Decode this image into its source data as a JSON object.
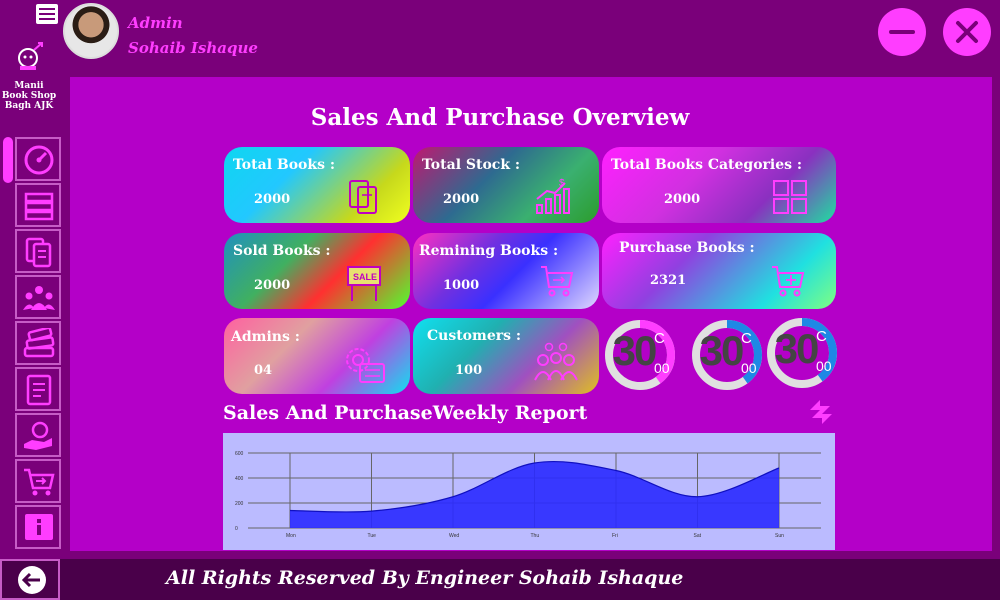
{
  "header": {
    "role": "Admin",
    "name": "Sohaib Ishaque"
  },
  "sidebar": {
    "shop_name": "Manii Book Shop Bagh AJK",
    "items": [
      {
        "icon": "dashboard-gauge-icon"
      },
      {
        "icon": "books-categories-icon"
      },
      {
        "icon": "books-list-icon"
      },
      {
        "icon": "users-group-icon"
      },
      {
        "icon": "books-stack-icon"
      },
      {
        "icon": "report-document-icon"
      },
      {
        "icon": "hand-money-icon"
      },
      {
        "icon": "cart-arrow-icon"
      },
      {
        "icon": "info-icon"
      }
    ]
  },
  "main": {
    "title": "Sales And Purchase Overview",
    "cards": [
      {
        "label": "Total Books :",
        "value": "2000",
        "icon": "books-icon"
      },
      {
        "label": "Total Stock :",
        "value": "2000",
        "icon": "stock-chart-icon"
      },
      {
        "label": "Total Books Categories :",
        "value": "2000",
        "icon": "categories-icon"
      },
      {
        "label": "Sold Books :",
        "value": "2000",
        "icon": "sale-sign-icon"
      },
      {
        "label": "Remining Books :",
        "value": "1000",
        "icon": "cart-return-icon"
      },
      {
        "label": "Purchase Books :",
        "value": "2321",
        "icon": "cart-add-icon"
      },
      {
        "label": "Admins :",
        "value": "04",
        "icon": "admin-gear-icon"
      },
      {
        "label": "Customers :",
        "value": "100",
        "icon": "customers-icon"
      }
    ],
    "rings": [
      {
        "value": "30",
        "unit": "C",
        "sub": "00",
        "percent": 40,
        "color": "#ff3dff"
      },
      {
        "value": "30",
        "unit": "C",
        "sub": "00",
        "percent": 40,
        "color": "#1e88e5"
      },
      {
        "value": "30",
        "unit": "C",
        "sub": "00",
        "percent": 40,
        "color": "#1e88e5"
      }
    ],
    "report_title": "Sales And PurchaseWeekly Report"
  },
  "chart_data": {
    "type": "area",
    "categories": [
      "Mon",
      "Tue",
      "Wed",
      "Thu",
      "Fri",
      "Sat",
      "Sun"
    ],
    "series": [
      {
        "values": [
          140,
          135,
          250,
          520,
          460,
          250,
          480
        ]
      }
    ],
    "y_ticks": [
      "0",
      "200",
      "400",
      "600"
    ],
    "ylim": [
      0,
      600
    ],
    "grid": true,
    "fill_color": "#2a2aff",
    "background": "#bbbbff"
  },
  "footer": {
    "text": "All Rights Reserved By Engineer Sohaib Ishaque"
  }
}
